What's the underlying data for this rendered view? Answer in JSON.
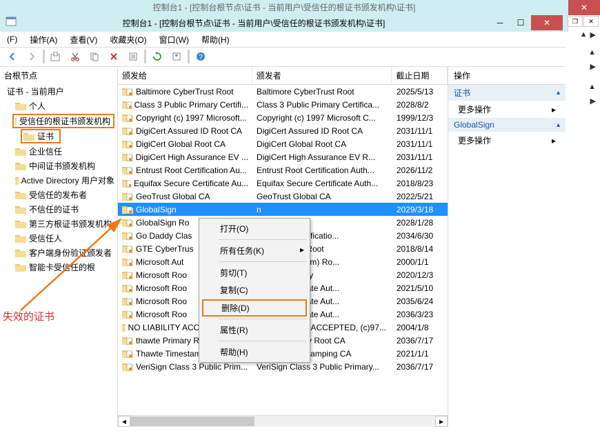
{
  "title_faint": "控制台1 - [控制台根节点\\证书 - 当前用户\\受信任的根证书颁发机构\\证书]",
  "title": "控制台1 - [控制台根节点\\证书 - 当前用户\\受信任的根证书颁发机构\\证书]",
  "menubar": {
    "file": "(F)",
    "action": "操作(A)",
    "view": "查看(V)",
    "fav": "收藏夹(O)",
    "win": "窗口(W)",
    "help": "帮助(H)"
  },
  "tree": {
    "root": "台根节点",
    "cert_user": "证书 - 当前用户",
    "personal": "个人",
    "trusted_root": "受信任的根证书颁发机构",
    "certs": "证书",
    "enterprise": "企业信任",
    "intermediate": "中间证书颁发机构",
    "ad": "Active Directory 用户对象",
    "trusted_pub": "受信任的发布者",
    "untrusted": "不信任的证书",
    "third": "第三方根证书颁发机构",
    "trustee": "受信任人",
    "client": "客户端身份验证颁发者",
    "smart": "智能卡受信任的根"
  },
  "columns": {
    "c1": "颁发给",
    "c2": "颁发者",
    "c3": "截止日期"
  },
  "rows": [
    {
      "c1": "Baltimore CyberTrust Root",
      "c2": "Baltimore CyberTrust Root",
      "c3": "2025/5/13"
    },
    {
      "c1": "Class 3 Public Primary Certifi...",
      "c2": "Class 3 Public Primary Certifica...",
      "c3": "2028/8/2"
    },
    {
      "c1": "Copyright (c) 1997 Microsoft...",
      "c2": "Copyright (c) 1997 Microsoft C...",
      "c3": "1999/12/3"
    },
    {
      "c1": "DigiCert Assured ID Root CA",
      "c2": "DigiCert Assured ID Root CA",
      "c3": "2031/11/1"
    },
    {
      "c1": "DigiCert Global Root CA",
      "c2": "DigiCert Global Root CA",
      "c3": "2031/11/1"
    },
    {
      "c1": "DigiCert High Assurance EV ...",
      "c2": "DigiCert High Assurance EV R...",
      "c3": "2031/11/1"
    },
    {
      "c1": "Entrust Root Certification Au...",
      "c2": "Entrust Root Certification Auth...",
      "c3": "2026/11/2"
    },
    {
      "c1": "Equifax Secure Certificate Au...",
      "c2": "Equifax Secure Certificate Auth...",
      "c3": "2018/8/23"
    },
    {
      "c1": "GeoTrust Global CA",
      "c2": "GeoTrust Global CA",
      "c3": "2022/5/21"
    },
    {
      "c1": "GlobalSign",
      "c2": "n",
      "c3": "2029/3/18",
      "sel": true
    },
    {
      "c1": "GlobalSign Ro",
      "c2": "n Root CA",
      "c3": "2028/1/28"
    },
    {
      "c1": "Go Daddy Clas",
      "c2": "y Class 2 Certificatio...",
      "c3": "2034/6/30"
    },
    {
      "c1": "GTE CyberTrus",
      "c2": "rTrust Global Root",
      "c3": "2018/8/14"
    },
    {
      "c1": "Microsoft Aut",
      "c2": " Authenticode(tm) Ro...",
      "c3": "2000/1/1"
    },
    {
      "c1": "Microsoft Roo",
      "c2": "t Root Authority",
      "c3": "2020/12/3"
    },
    {
      "c1": "Microsoft Roo",
      "c2": "t Root Certificate Aut...",
      "c3": "2021/5/10"
    },
    {
      "c1": "Microsoft Roo",
      "c2": "t Root Certificate Aut...",
      "c3": "2035/6/24"
    },
    {
      "c1": "Microsoft Roo",
      "c2": "t Root Certificate Aut...",
      "c3": "2036/3/23"
    },
    {
      "c1": "NO LIABILITY ACCEPTED, (c)...",
      "c2": "NO LIABILITY ACCEPTED, (c)97...",
      "c3": "2004/1/8"
    },
    {
      "c1": "thawte Primary Root CA",
      "c2": "thawte Primary Root CA",
      "c3": "2036/7/17"
    },
    {
      "c1": "Thawte Timestamping CA",
      "c2": "Thawte Timestamping CA",
      "c3": "2021/1/1"
    },
    {
      "c1": "VeriSign Class 3 Public Prim...",
      "c2": "VeriSign Class 3 Public Primary...",
      "c3": "2036/7/17"
    }
  ],
  "actions": {
    "head": "操作",
    "sec1": "证书",
    "more": "更多操作",
    "sec2": "GlobalSign"
  },
  "ctx": {
    "open": "打开(O)",
    "all": "所有任务(K)",
    "cut": "剪切(T)",
    "copy": "复制(C)",
    "delete": "删除(D)",
    "prop": "属性(R)",
    "help": "帮助(H)"
  },
  "annotation": "失效的证书"
}
